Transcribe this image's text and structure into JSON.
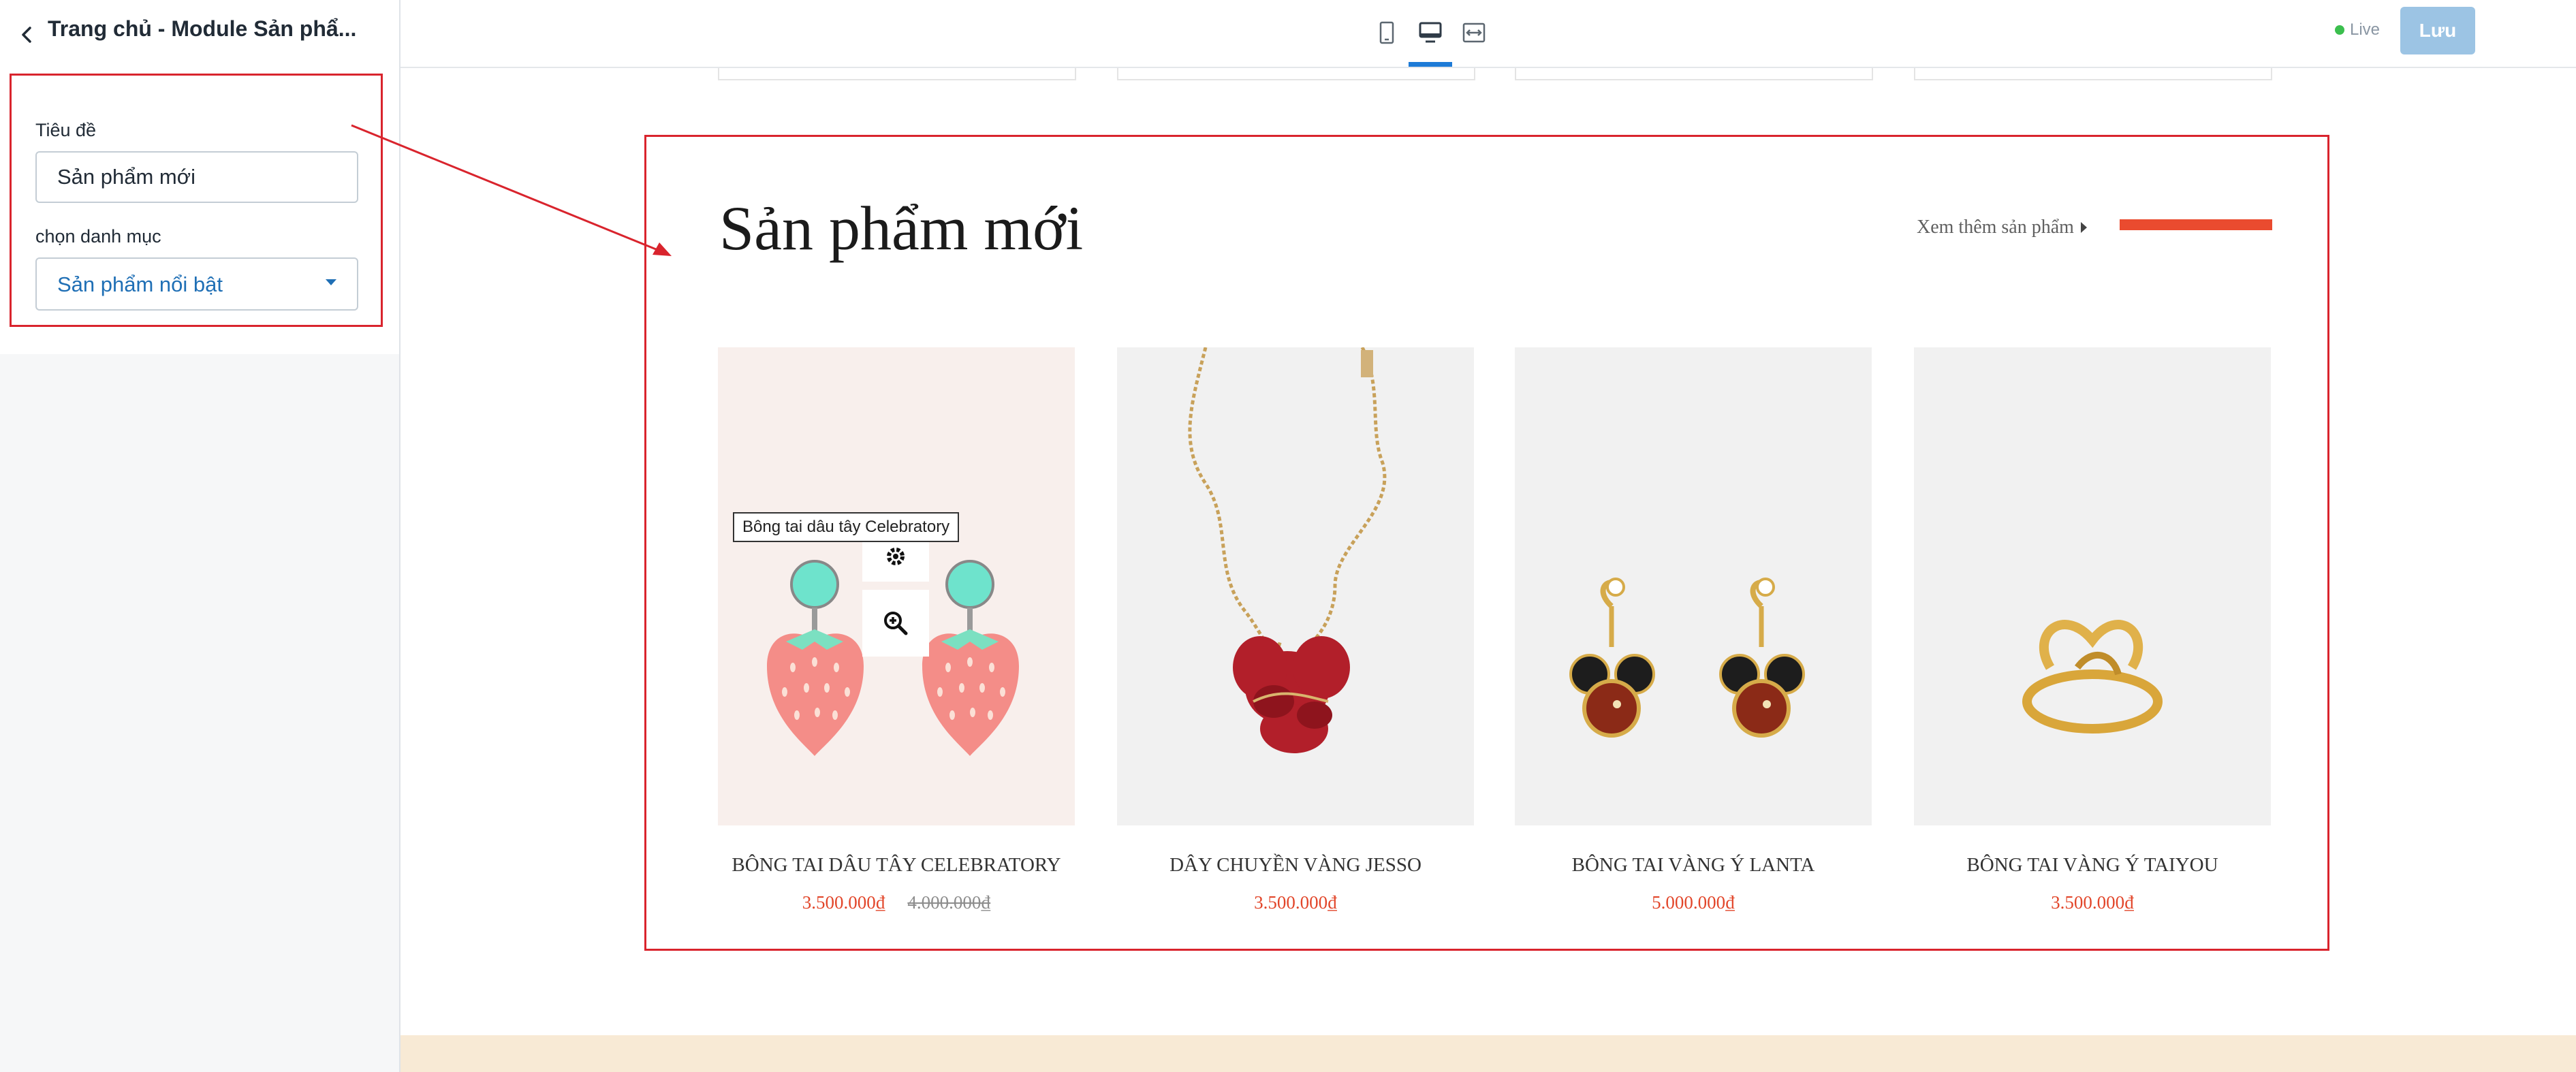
{
  "sidebar": {
    "title": "Trang chủ - Module Sản phẩ...",
    "fields": {
      "title_label": "Tiêu đề",
      "title_value": "Sản phẩm mới",
      "category_label": "chọn danh mục",
      "category_value": "Sản phẩm nổi bật"
    }
  },
  "toolbar": {
    "devices": [
      "mobile-icon",
      "desktop-icon",
      "fullwidth-icon"
    ],
    "active_device": "desktop",
    "live_label": "Live",
    "save_label": "Lưu"
  },
  "colors": {
    "accent": "#ea4b2f",
    "annotation": "#d9242d",
    "active_tab": "#1d7bd7",
    "category_text": "#1f6fb5",
    "save_button": "#9cc4e4",
    "live_dot": "#3bbf4e",
    "footer": "#f8ead5"
  },
  "preview": {
    "section_title": "Sản phẩm mới",
    "view_more": "Xem thêm sản phẩm",
    "tooltip": "Bông tai dâu tây Celebratory",
    "products": [
      {
        "name": "BÔNG TAI DÂU TÂY CELEBRATORY",
        "price": "3.500.000₫",
        "old_price": "4.000.000₫"
      },
      {
        "name": "DÂY CHUYỀN VÀNG JESSO",
        "price": "3.500.000₫",
        "old_price": ""
      },
      {
        "name": "BÔNG TAI VÀNG Ý LANTA",
        "price": "5.000.000₫",
        "old_price": ""
      },
      {
        "name": "BÔNG TAI VÀNG Ý TAIYOU",
        "price": "3.500.000₫",
        "old_price": ""
      }
    ]
  }
}
